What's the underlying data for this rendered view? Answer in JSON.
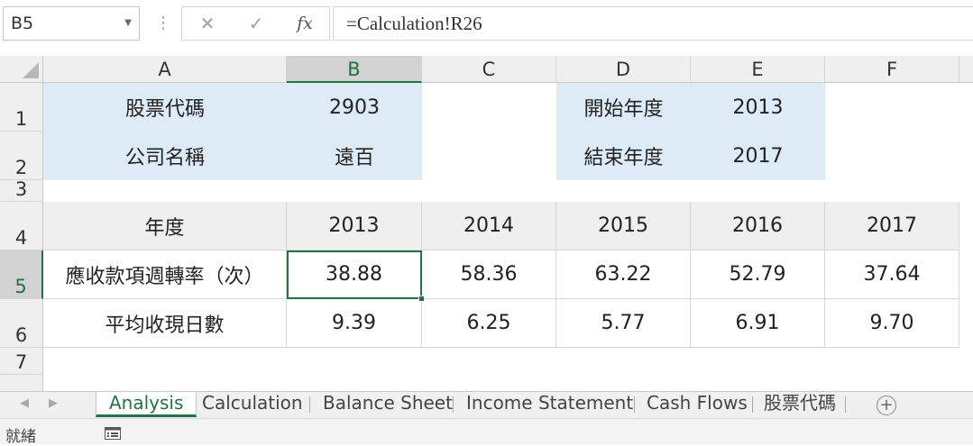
{
  "formula_bar": {
    "name_box": "B5",
    "cancel_icon": "✕",
    "enter_icon": "✓",
    "fx_label": "fx",
    "formula": "=Calculation!R26"
  },
  "columns": [
    "A",
    "B",
    "C",
    "D",
    "E",
    "F"
  ],
  "rows": [
    "1",
    "2",
    "3",
    "4",
    "5",
    "6",
    "7"
  ],
  "info": {
    "stock_code_label": "股票代碼",
    "stock_code": "2903",
    "company_label": "公司名稱",
    "company": "遠百",
    "start_label": "開始年度",
    "start_year": "2013",
    "end_label": "結束年度",
    "end_year": "2017"
  },
  "table": {
    "header": [
      "年度",
      "2013",
      "2014",
      "2015",
      "2016",
      "2017"
    ],
    "rows": [
      [
        "應收款項週轉率（次）",
        "38.88",
        "58.36",
        "63.22",
        "52.79",
        "37.64"
      ],
      [
        "平均收現日數",
        "9.39",
        "6.25",
        "5.77",
        "6.91",
        "9.70"
      ]
    ]
  },
  "sheet_tabs": [
    "Analysis",
    "Calculation",
    "Balance Sheet",
    "Income Statement",
    "Cash Flows",
    "股票代碼"
  ],
  "add_sheet": "+",
  "status": "就緒"
}
